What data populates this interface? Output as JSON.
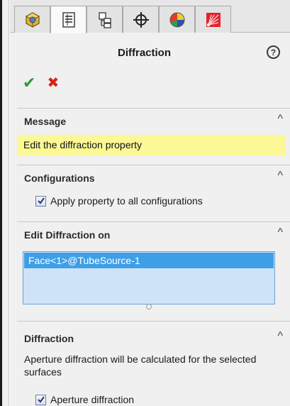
{
  "tabs": [
    {
      "name": "part-icon"
    },
    {
      "name": "property-manager-icon"
    },
    {
      "name": "configuration-manager-icon"
    },
    {
      "name": "dimxpert-icon"
    },
    {
      "name": "appearance-icon"
    },
    {
      "name": "optical-source-icon"
    }
  ],
  "header": {
    "title": "Diffraction",
    "help": "?"
  },
  "actions": {
    "ok": "✔",
    "cancel": "✖"
  },
  "sections": {
    "message": {
      "title": "Message",
      "caret": "^",
      "text": "Edit the diffraction property"
    },
    "configurations": {
      "title": "Configurations",
      "caret": "^",
      "checkbox_label": "Apply property to all configurations"
    },
    "edit_on": {
      "title": "Edit Diffraction on",
      "caret": "^",
      "items": [
        "Face<1>@TubeSource-1"
      ]
    },
    "diffraction": {
      "title": "Diffraction",
      "caret": "^",
      "description": "Aperture diffraction will be calculated for the selected surfaces",
      "checkbox_label": "Aperture diffraction"
    }
  },
  "colors": {
    "message_bg": "#fbf895",
    "selection": "#3f9fe6",
    "ok": "#2f9a3a",
    "cancel": "#d6271a"
  }
}
